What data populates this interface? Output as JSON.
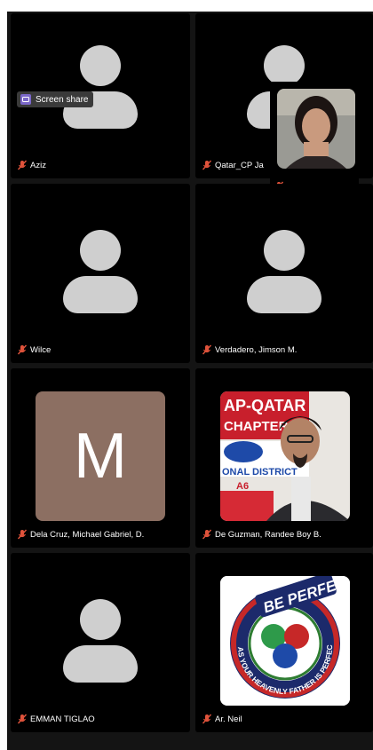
{
  "screen_share": {
    "label": "Screen share"
  },
  "participants": [
    {
      "name": "Aziz",
      "muted": true,
      "avatar": "silhouette"
    },
    {
      "name": "Qatar_CP Ja",
      "muted": true,
      "avatar": "silhouette"
    },
    {
      "name": "Wilce",
      "muted": true,
      "avatar": "silhouette"
    },
    {
      "name": "Verdadero, Jimson M.",
      "muted": true,
      "avatar": "silhouette"
    },
    {
      "name": "Dela Cruz, Michael Gabriel, D.",
      "muted": true,
      "avatar": "initial",
      "initial": "M",
      "color": "#8c6f62"
    },
    {
      "name": "De Guzman, Randee Boy B.",
      "muted": true,
      "avatar": "photo"
    },
    {
      "name": "EMMAN TIGLAO",
      "muted": true,
      "avatar": "silhouette"
    },
    {
      "name": "Ar. Neil",
      "muted": true,
      "avatar": "logo"
    }
  ],
  "logo": {
    "top_text": "BE PERFECT",
    "ring_text": "AS YOUR HEAVENLY FATHER IS PERFECT"
  },
  "banner": {
    "line1": "AP-QATAR",
    "line2": "CHAPTER",
    "line3": "ONAL DISTRICT",
    "line4": "A6"
  },
  "colors": {
    "muted_mic": "#e0533b",
    "tile_bg": "#000000",
    "stage_bg": "#141414",
    "avatar_gray": "#cfcfcf"
  }
}
